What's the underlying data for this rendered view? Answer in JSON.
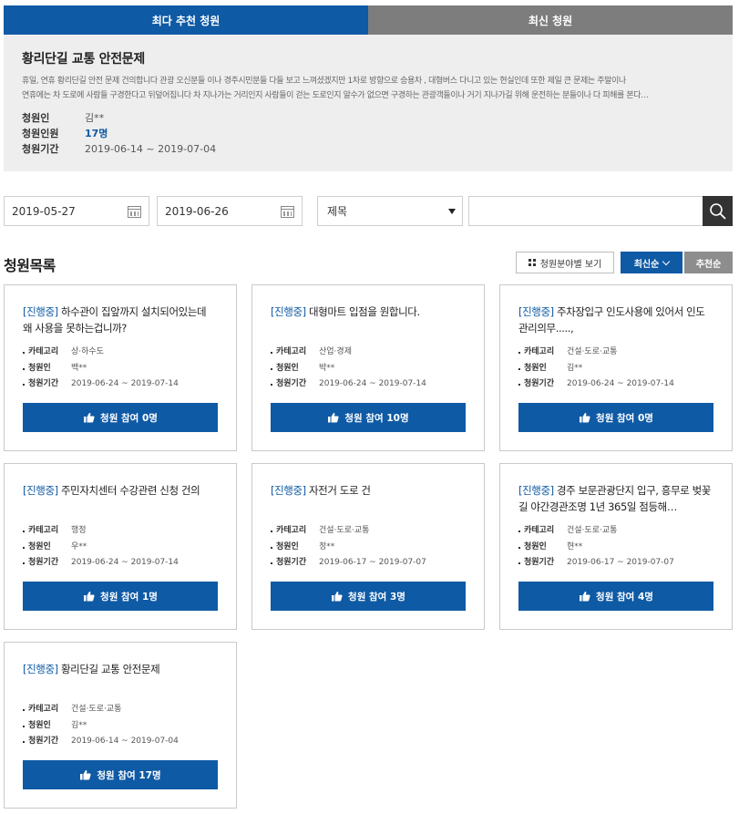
{
  "tabs": [
    {
      "label": "최다 추천 청원"
    },
    {
      "label": "최신 청원"
    }
  ],
  "featured": {
    "title": "황리단길 교통 안전문제",
    "body_line1": "휴일, 연휴 황리단길 안전 문제 건의합니다 관광 오신분들 이나 경주시민분들 다들 보고 느껴셨겠지만 1차로 방향으로 승용차 , 대형버스 다니고 있는 현실인데 또한 제일 큰 문제는 주말이나",
    "body_line2": "연휴에는 차 도로에 사람들 구경한다고 뒤덮어집니다 차 지나가는 거리인지 사람들이 걷는 도로인지 알수가 없으면 구경하는 관광객들이나 거기 지나가길 위해 운전하는 분들이나 다 피해를 본다…",
    "petitioner_label": "청원인",
    "petitioner": "김**",
    "count_label": "청원인원",
    "count": "17명",
    "period_label": "청원기간",
    "period": "2019-06-14 ~ 2019-07-04"
  },
  "search": {
    "start_date": "2019-05-27",
    "end_date": "2019-06-26",
    "field": "제목",
    "query": ""
  },
  "list": {
    "title": "청원목록",
    "category_btn": "청원분야별 보기",
    "latest_btn": "최신순",
    "recommend_btn": "추천순",
    "meta_labels": {
      "category": "카테고리",
      "petitioner": "청원인",
      "period": "청원기간"
    },
    "items": [
      {
        "status": "[진행중]",
        "title": "하수관이 집앞까지 설치되어있는데 왜 사용을 못하는겁니까?",
        "category": "상·하수도",
        "petitioner": "백**",
        "period": "2019-06-24 ~ 2019-07-14",
        "button": "청원 참여 0명"
      },
      {
        "status": "[진행중]",
        "title": "대형마트 입점을 원합니다.",
        "category": "산업·경제",
        "petitioner": "박**",
        "period": "2019-06-24 ~ 2019-07-14",
        "button": "청원 참여 10명"
      },
      {
        "status": "[진행중]",
        "title": "주차장입구 인도사용에 있어서 인도관리의무.....,",
        "category": "건설·도로·교통",
        "petitioner": "김**",
        "period": "2019-06-24 ~ 2019-07-14",
        "button": "청원 참여 0명"
      },
      {
        "status": "[진행중]",
        "title": "주민자치센터 수강관련 신청 건의",
        "category": "행정",
        "petitioner": "우**",
        "period": "2019-06-24 ~ 2019-07-14",
        "button": "청원 참여 1명"
      },
      {
        "status": "[진행중]",
        "title": "자전거 도로 건",
        "category": "건설·도로·교통",
        "petitioner": "정**",
        "period": "2019-06-17 ~ 2019-07-07",
        "button": "청원 참여 3명"
      },
      {
        "status": "[진행중]",
        "title": "경주 보문관광단지 입구, 흥무로 벚꽃길 야간경관조명 1년 365일 점등해…",
        "category": "건설·도로·교통",
        "petitioner": "현**",
        "period": "2019-06-17 ~ 2019-07-07",
        "button": "청원 참여 4명"
      },
      {
        "status": "[진행중]",
        "title": "황리단길 교통 안전문제",
        "category": "건설·도로·교통",
        "petitioner": "김**",
        "period": "2019-06-14 ~ 2019-07-04",
        "button": "청원 참여 17명"
      }
    ]
  }
}
